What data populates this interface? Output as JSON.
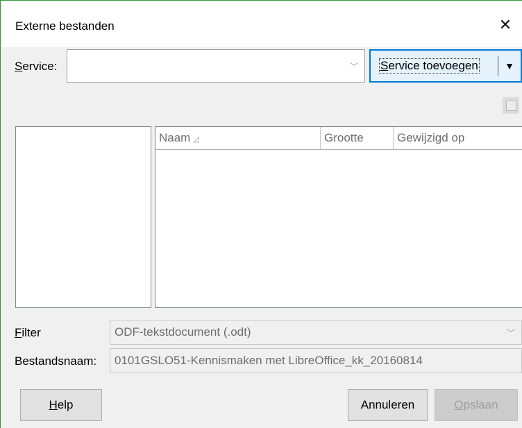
{
  "window": {
    "title": "Externe bestanden",
    "close_icon": "close-icon"
  },
  "service": {
    "label_prefix": "S",
    "label_rest": "ervice:",
    "value": "",
    "add_button_prefix": "S",
    "add_button_rest": "ervice toevoegen"
  },
  "file_list": {
    "columns": [
      {
        "label": "Naam"
      },
      {
        "label": "Grootte"
      },
      {
        "label": "Gewijzigd op"
      }
    ],
    "sort_indicator": "sort-ascending-icon"
  },
  "filter": {
    "label_prefix": "F",
    "label_rest": "ilter",
    "value": "ODF-tekstdocument (.odt)"
  },
  "filename": {
    "label": "Bestandsnaam:",
    "value": "0101GSLO51-Kennismaken met LibreOffice_kk_20160814"
  },
  "buttons": {
    "help_prefix": "H",
    "help_rest": "elp",
    "cancel": "Annuleren",
    "save_prefix": "O",
    "save_rest": "pslaan"
  }
}
